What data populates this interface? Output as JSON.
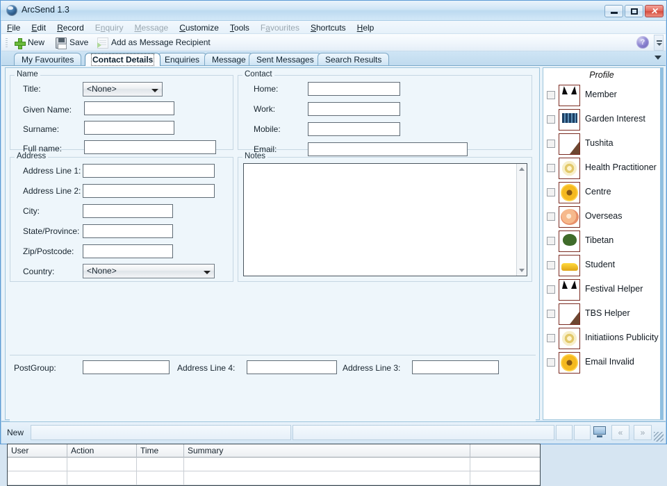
{
  "window": {
    "title": "ArcSend 1.3",
    "app_icon": "sphere-icon",
    "controls": {
      "minimize": "minimize-icon",
      "maximize": "maximize-icon",
      "close": "✕"
    }
  },
  "menubar": {
    "items": [
      {
        "label": "File",
        "accel": "F",
        "disabled": false
      },
      {
        "label": "Edit",
        "accel": "E",
        "disabled": false
      },
      {
        "label": "Record",
        "accel": "R",
        "disabled": false
      },
      {
        "label": "Enquiry",
        "accel": "n",
        "disabled": true
      },
      {
        "label": "Message",
        "accel": "M",
        "disabled": true
      },
      {
        "label": "Customize",
        "accel": "C",
        "disabled": false
      },
      {
        "label": "Tools",
        "accel": "T",
        "disabled": false
      },
      {
        "label": "Favourites",
        "accel": "a",
        "disabled": true
      },
      {
        "label": "Shortcuts",
        "accel": "S",
        "disabled": false
      },
      {
        "label": "Help",
        "accel": "H",
        "disabled": false
      }
    ]
  },
  "toolbar": {
    "new_label": "New",
    "save_label": "Save",
    "add_recipient_label": "Add as Message Recipient",
    "help_glyph": "?",
    "overflow": "toolbar-overflow"
  },
  "tabs": [
    {
      "label": "My Favourites",
      "active": false
    },
    {
      "label": "Contact Details",
      "active": true
    },
    {
      "label": "Enquiries",
      "active": false
    },
    {
      "label": "Message",
      "active": false
    },
    {
      "label": "Sent Messages",
      "active": false
    },
    {
      "label": "Search Results",
      "active": false
    }
  ],
  "form": {
    "name_group": {
      "legend": "Name",
      "title_label": "Title:",
      "title_value": "<None>",
      "given_label": "Given Name:",
      "given_value": "",
      "surname_label": "Surname:",
      "surname_value": "",
      "fullname_label": "Full name:",
      "fullname_value": ""
    },
    "contact_group": {
      "legend": "Contact",
      "home_label": "Home:",
      "home_value": "",
      "work_label": "Work:",
      "work_value": "",
      "mobile_label": "Mobile:",
      "mobile_value": "",
      "email_label": "Email:",
      "email_value": ""
    },
    "address_group": {
      "legend": "Address",
      "line1_label": "Address Line 1:",
      "line1_value": "",
      "line2_label": "Address Line 2:",
      "line2_value": "",
      "city_label": "City:",
      "city_value": "",
      "state_label": "State/Province:",
      "state_value": "",
      "zip_label": "Zip/Postcode:",
      "zip_value": "",
      "country_label": "Country:",
      "country_value": "<None>"
    },
    "notes_group": {
      "legend": "Notes",
      "notes_value": ""
    },
    "post_row": {
      "postgroup_label": "PostGroup:",
      "postgroup_value": "",
      "line4_label": "Address Line 4:",
      "line4_value": "",
      "line3_label": "Address Line 3:",
      "line3_value": ""
    }
  },
  "history_grid": {
    "columns": [
      "User",
      "Action",
      "Time",
      "Summary",
      ""
    ],
    "rows": [
      [
        "",
        "",
        "",
        "",
        ""
      ],
      [
        "",
        "",
        "",
        "",
        ""
      ]
    ]
  },
  "profile": {
    "title": "Profile",
    "items": [
      {
        "label": "Member",
        "thumb": "cat-thumb",
        "checked": false
      },
      {
        "label": "Garden Interest",
        "thumb": "city-thumb",
        "checked": false
      },
      {
        "label": "Tushita",
        "thumb": "beach-thumb",
        "checked": false
      },
      {
        "label": "Health Practitioner",
        "thumb": "mandala-thumb",
        "checked": false
      },
      {
        "label": "Centre",
        "thumb": "sunflower-thumb",
        "checked": false
      },
      {
        "label": "Overseas",
        "thumb": "rose-thumb",
        "checked": false
      },
      {
        "label": "Tibetan",
        "thumb": "tree-thumb",
        "checked": false
      },
      {
        "label": "Student",
        "thumb": "car-thumb",
        "checked": false
      },
      {
        "label": "Festival Helper",
        "thumb": "cat-thumb",
        "checked": false
      },
      {
        "label": "TBS Helper",
        "thumb": "beach-thumb",
        "checked": false
      },
      {
        "label": "Initiatiions Publicity",
        "thumb": "mandala-thumb",
        "checked": false
      },
      {
        "label": "Email Invalid",
        "thumb": "sunflower-thumb",
        "checked": false
      }
    ]
  },
  "statusbar": {
    "mode_text": "New",
    "panel1_text": "",
    "panel2_text": "",
    "prev_label": "«",
    "next_label": "»",
    "screen_icon": "monitor-icon"
  }
}
